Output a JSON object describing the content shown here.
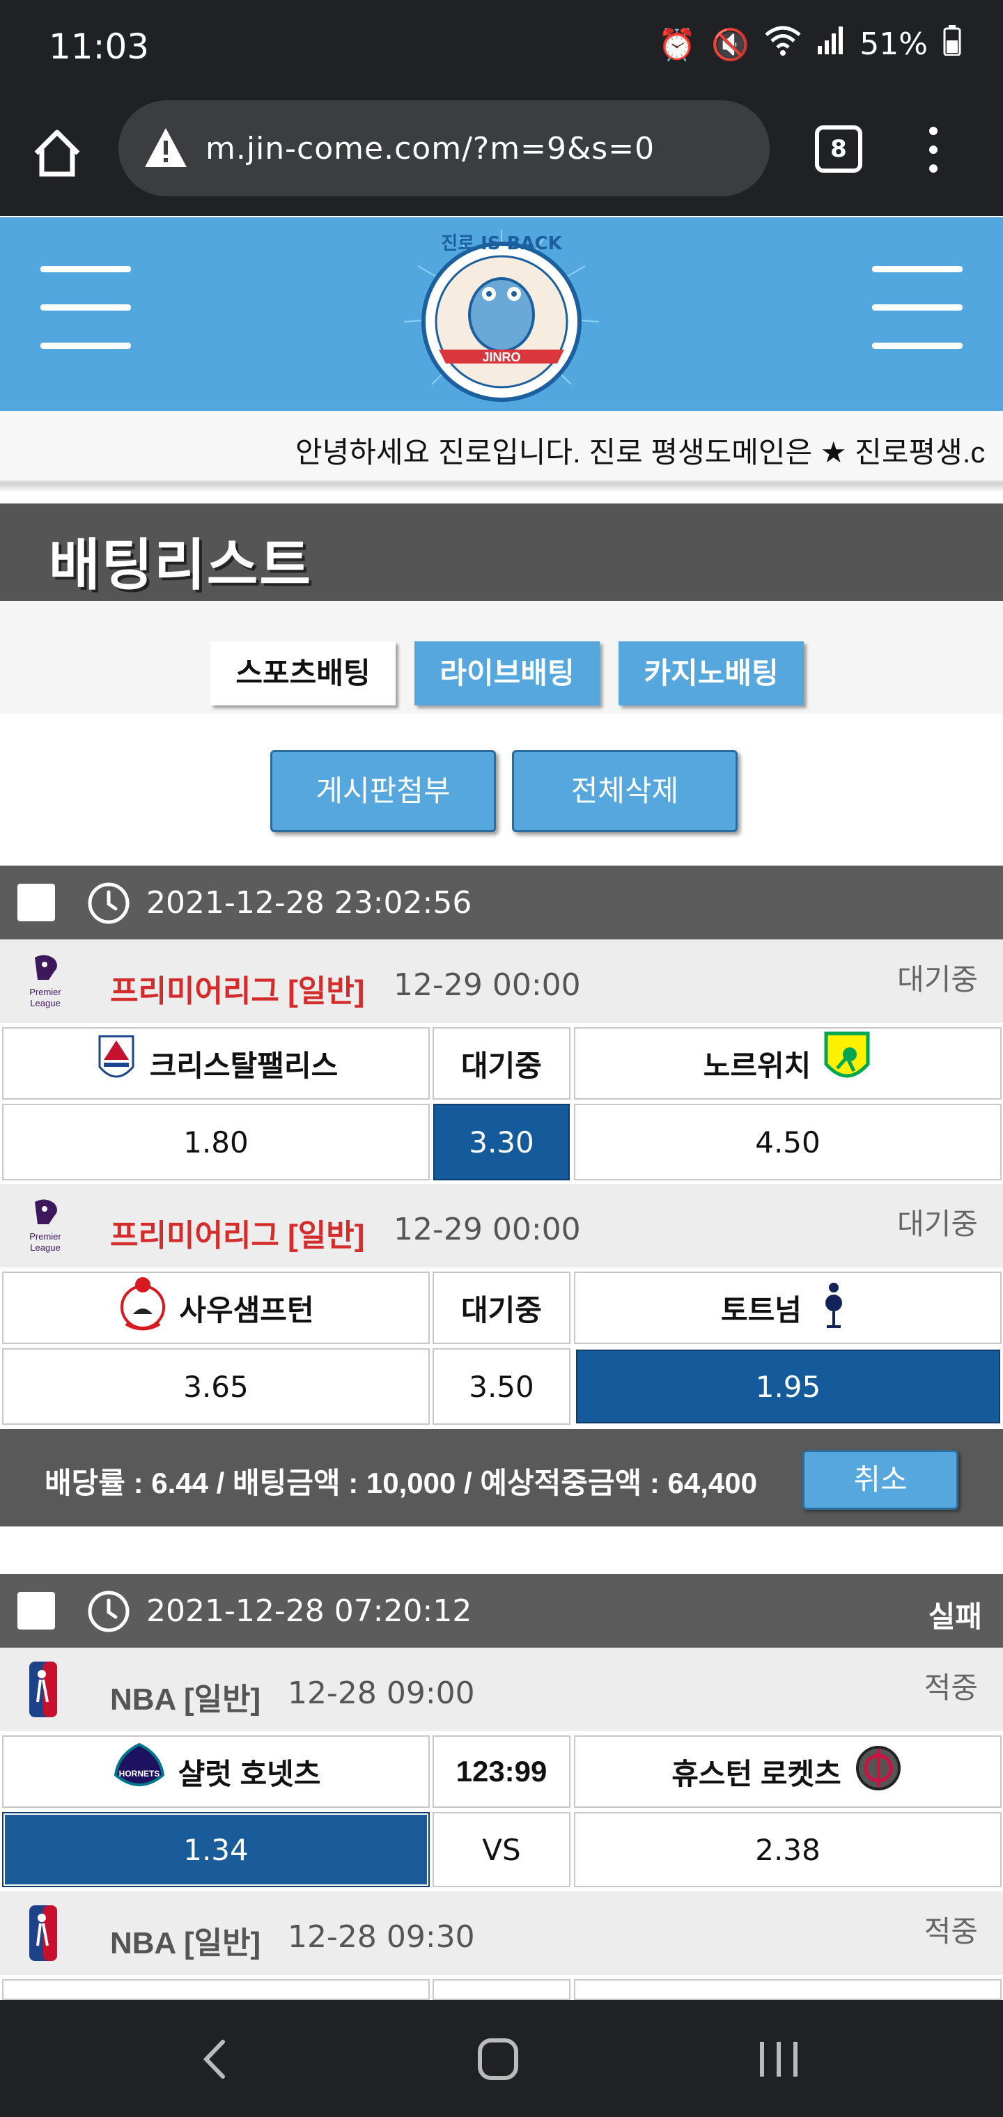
{
  "status_bar": {
    "time": "11:03",
    "battery": "51%"
  },
  "browser": {
    "url": "m.jin-come.com/?m=9&s=0",
    "tab_count": "8"
  },
  "header": {
    "logo_text": "JINRO",
    "logo_tagline": "진로 IS BACK"
  },
  "notice": "안녕하세요 진로입니다. 진로 평생도메인은 ★ 진로평생.c",
  "page_title": "배팅리스트",
  "tabs": [
    "스포츠배팅",
    "라이브배팅",
    "카지노배팅"
  ],
  "actions": {
    "attach": "게시판첨부",
    "delete_all": "전체삭제"
  },
  "groups": [
    {
      "datetime": "2021-12-28 23:02:56",
      "status": "",
      "summary": "배당률 : 6.44 / 배팅금액 : 10,000 / 예상적중금액 : 64,400",
      "cancel_label": "취소",
      "matches": [
        {
          "league": "프리미어리그",
          "type": "[일반]",
          "time": "12-29 00:00",
          "status": "대기중",
          "home": "크리스탈팰리스",
          "middle": "대기중",
          "away": "노르위치",
          "home_odd": "1.80",
          "draw_odd": "3.30",
          "away_odd": "4.50",
          "selected": "draw"
        },
        {
          "league": "프리미어리그",
          "type": "[일반]",
          "time": "12-29 00:00",
          "status": "대기중",
          "home": "사우샘프턴",
          "middle": "대기중",
          "away": "토트넘",
          "home_odd": "3.65",
          "draw_odd": "3.50",
          "away_odd": "1.95",
          "selected": "away"
        }
      ]
    },
    {
      "datetime": "2021-12-28 07:20:12",
      "status": "실패",
      "matches": [
        {
          "league": "NBA",
          "type": "[일반]",
          "time": "12-28 09:00",
          "status": "적중",
          "home": "샬럿 호넷츠",
          "middle": "123:99",
          "away": "휴스턴 로켓츠",
          "home_odd": "1.34",
          "draw_odd": "VS",
          "away_odd": "2.38",
          "selected": "home"
        },
        {
          "league": "NBA",
          "type": "[일반]",
          "time": "12-28 09:30",
          "status": "적중"
        }
      ]
    }
  ],
  "icons": {
    "home": "home-icon",
    "warning": "warning-icon",
    "menu": "more-vert-icon",
    "clock": "clock-icon",
    "epl": "premier-league-icon",
    "nba": "nba-icon"
  },
  "colors": {
    "header_blue": "#52a7de",
    "selected_blue": "#155a9b",
    "league_red": "#d42b2b"
  }
}
